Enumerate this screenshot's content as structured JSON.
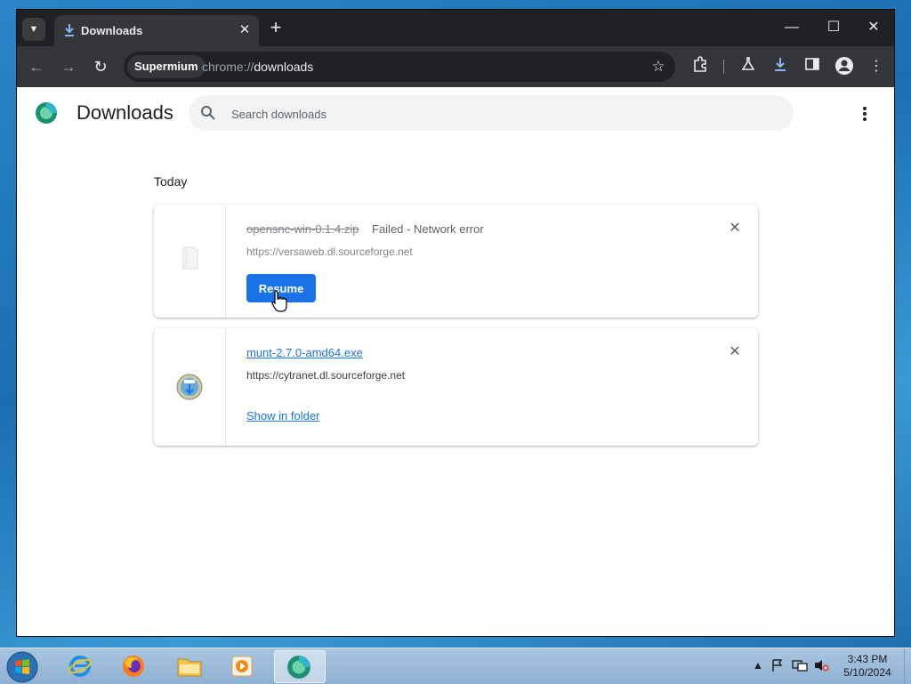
{
  "window": {
    "tab_title": "Downloads",
    "omnibox_chip": "Supermium",
    "url_scheme": "chrome://",
    "url_path": "downloads"
  },
  "page": {
    "title": "Downloads",
    "search_placeholder": "Search downloads",
    "date_header": "Today"
  },
  "downloads": [
    {
      "file_name": "opensnc-win-0.1.4.zip",
      "status": "Failed - Network error",
      "source": "https://versaweb.dl.sourceforge.net",
      "action_label": "Resume"
    },
    {
      "file_name": "munt-2.7.0-amd64.exe",
      "source": "https://cytranet.dl.sourceforge.net",
      "action_label": "Show in folder"
    }
  ],
  "taskbar": {
    "time": "3:43 PM",
    "date": "5/10/2024"
  },
  "colors": {
    "accent": "#1a73e8",
    "tabstrip": "#202124",
    "toolbar": "#35363a"
  }
}
